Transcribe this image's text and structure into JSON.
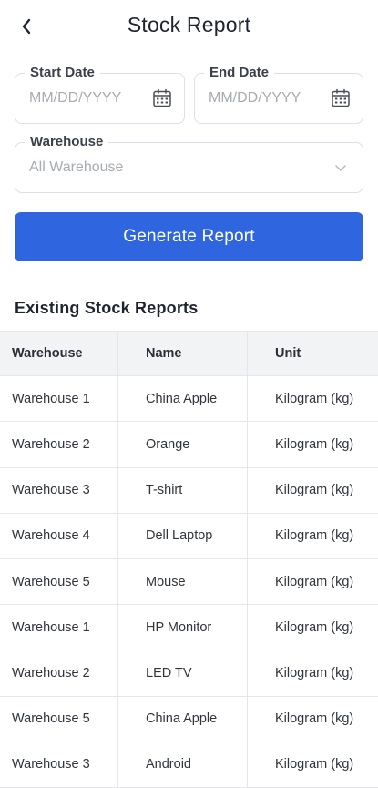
{
  "header": {
    "title": "Stock Report",
    "back_icon": "chevron-left-icon"
  },
  "filters": {
    "start_date": {
      "label": "Start Date",
      "placeholder": "MM/DD/YYYY",
      "icon": "calendar-icon"
    },
    "end_date": {
      "label": "End Date",
      "placeholder": "MM/DD/YYYY",
      "icon": "calendar-icon"
    },
    "warehouse": {
      "label": "Warehouse",
      "value": "All Warehouse",
      "icon": "chevron-down-icon"
    }
  },
  "actions": {
    "generate_label": "Generate Report"
  },
  "colors": {
    "primary": "#2f66e0",
    "header_bg": "#f2f3f5",
    "border": "#e4e6ea"
  },
  "reports": {
    "title": "Existing Stock Reports",
    "columns": [
      "Warehouse",
      "Name",
      "Unit"
    ],
    "rows": [
      {
        "warehouse": "Warehouse 1",
        "name": "China Apple",
        "unit": "Kilogram (kg)"
      },
      {
        "warehouse": "Warehouse 2",
        "name": "Orange",
        "unit": "Kilogram (kg)"
      },
      {
        "warehouse": "Warehouse 3",
        "name": "T-shirt",
        "unit": "Kilogram (kg)"
      },
      {
        "warehouse": "Warehouse 4",
        "name": "Dell Laptop",
        "unit": "Kilogram (kg)"
      },
      {
        "warehouse": "Warehouse 5",
        "name": "Mouse",
        "unit": "Kilogram (kg)"
      },
      {
        "warehouse": "Warehouse 1",
        "name": "HP Monitor",
        "unit": "Kilogram (kg)"
      },
      {
        "warehouse": "Warehouse 2",
        "name": "LED TV",
        "unit": "Kilogram (kg)"
      },
      {
        "warehouse": "Warehouse 5",
        "name": "China Apple",
        "unit": "Kilogram (kg)"
      },
      {
        "warehouse": "Warehouse 3",
        "name": "Android",
        "unit": "Kilogram (kg)"
      }
    ]
  }
}
